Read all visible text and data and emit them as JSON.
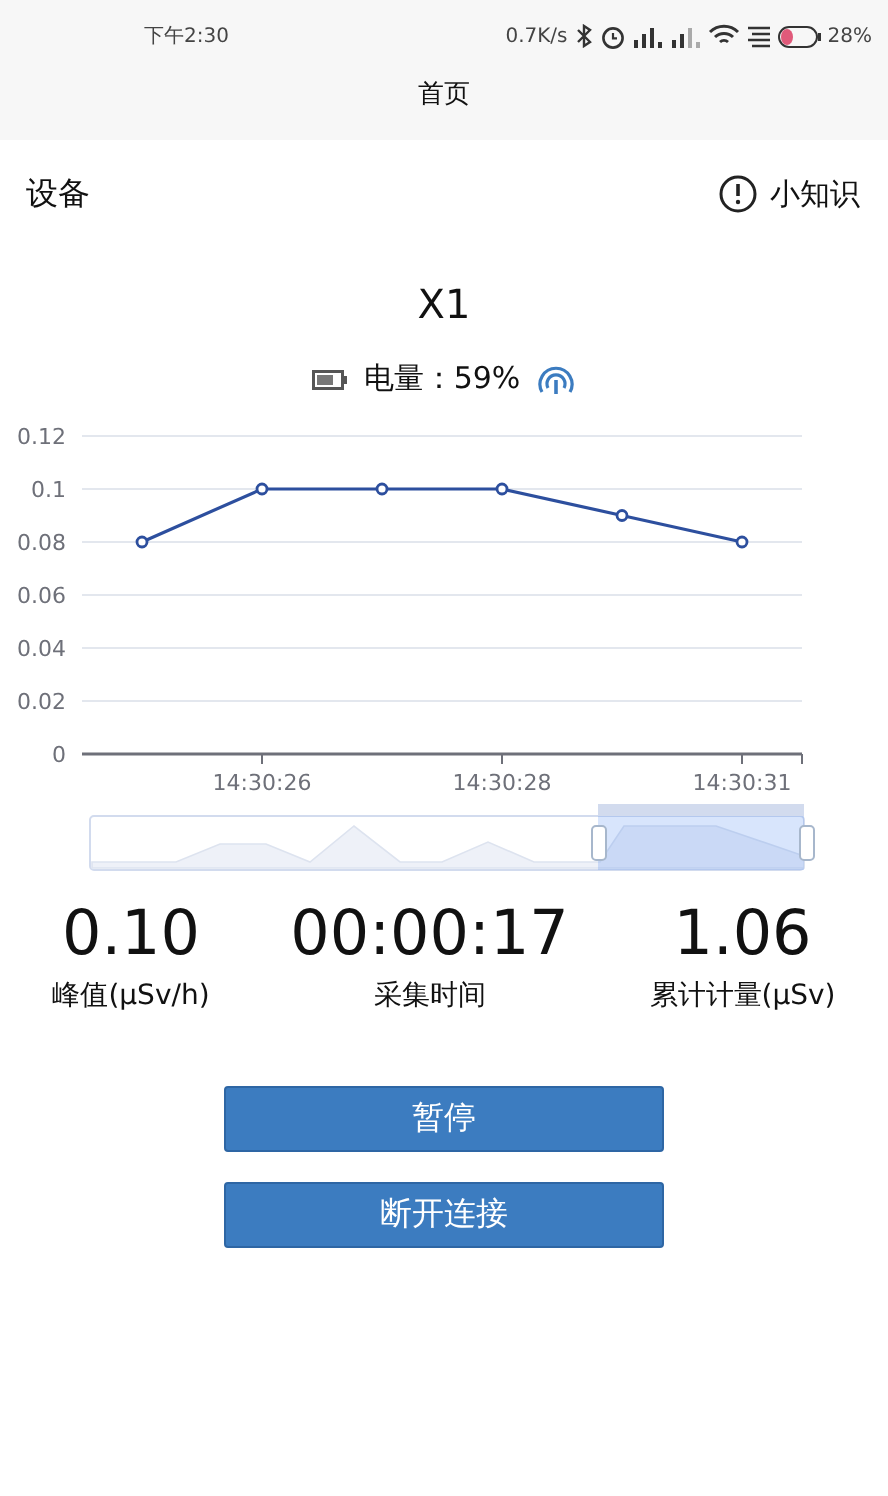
{
  "status_bar": {
    "time": "下午2:30",
    "speed": "0.7K/s",
    "battery": "28%"
  },
  "title": "首页",
  "header": {
    "left": "设备",
    "help": "小知识"
  },
  "device": {
    "name": "X1",
    "battery_label": "电量：59%"
  },
  "chart": {
    "x_labels": [
      "14:30:26",
      "14:30:28",
      "14:30:31"
    ],
    "chart_data": {
      "type": "line",
      "grid": true,
      "ylim": [
        0,
        0.12
      ],
      "yticks": [
        0,
        0.02,
        0.04,
        0.06,
        0.08,
        0.1,
        0.12
      ],
      "series": [
        {
          "color": "#2d4f9e",
          "marker": true,
          "values": [
            0.08,
            0.1,
            0.1,
            0.1,
            0.09,
            0.08
          ]
        }
      ]
    }
  },
  "stats": [
    {
      "value": "0.10",
      "label": "峰值(μSv/h)"
    },
    {
      "value": "00:00:17",
      "label": "采集时间"
    },
    {
      "value": "1.06",
      "label": "累计计量(μSv)"
    }
  ],
  "buttons": [
    "暂停",
    "断开连接"
  ]
}
